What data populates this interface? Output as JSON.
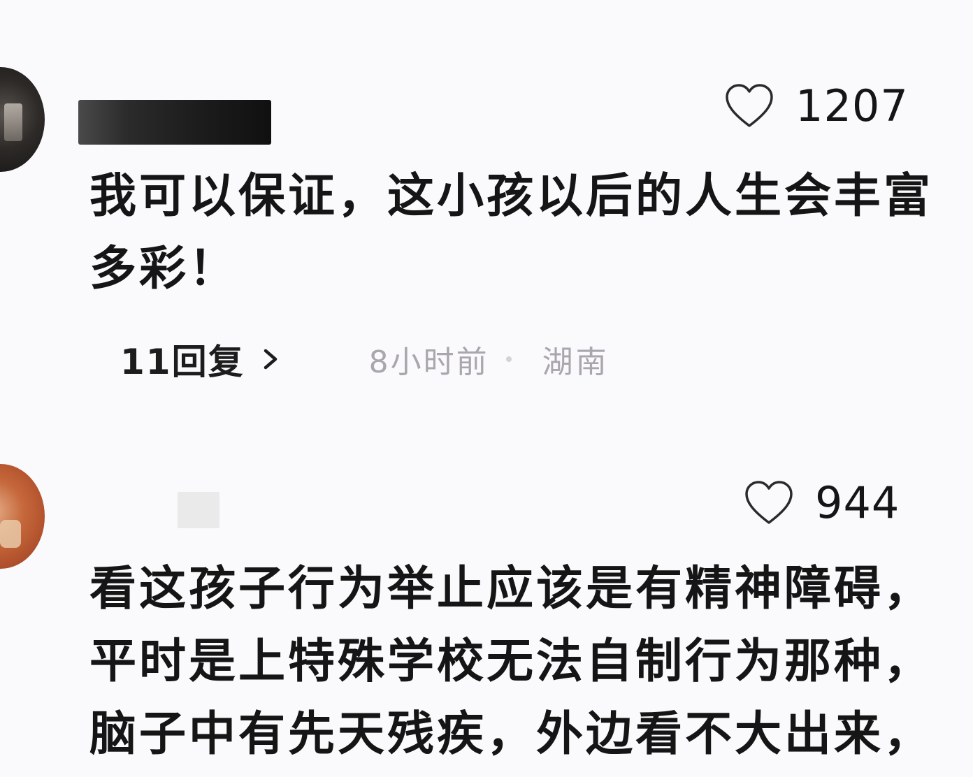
{
  "comments": [
    {
      "likes": "1207",
      "text_lines": [
        "我可以保证，这小孩以后的人生会丰富",
        "多彩！"
      ],
      "replies_label": "11回复",
      "time": "8小时前",
      "location": "湖南"
    },
    {
      "likes": "944",
      "text_lines": [
        "看这孩子行为举止应该是有精神障碍，",
        "平时是上特殊学校无法自制行为那种，",
        "脑子中有先天残疾，外边看不大出来，"
      ]
    }
  ],
  "icons": {
    "like": "heart-outline-icon",
    "replies_arrow": "chevron-right-icon"
  },
  "colors": {
    "background": "#faf9fc",
    "text": "#151515",
    "meta_text": "#a9a6ad"
  }
}
